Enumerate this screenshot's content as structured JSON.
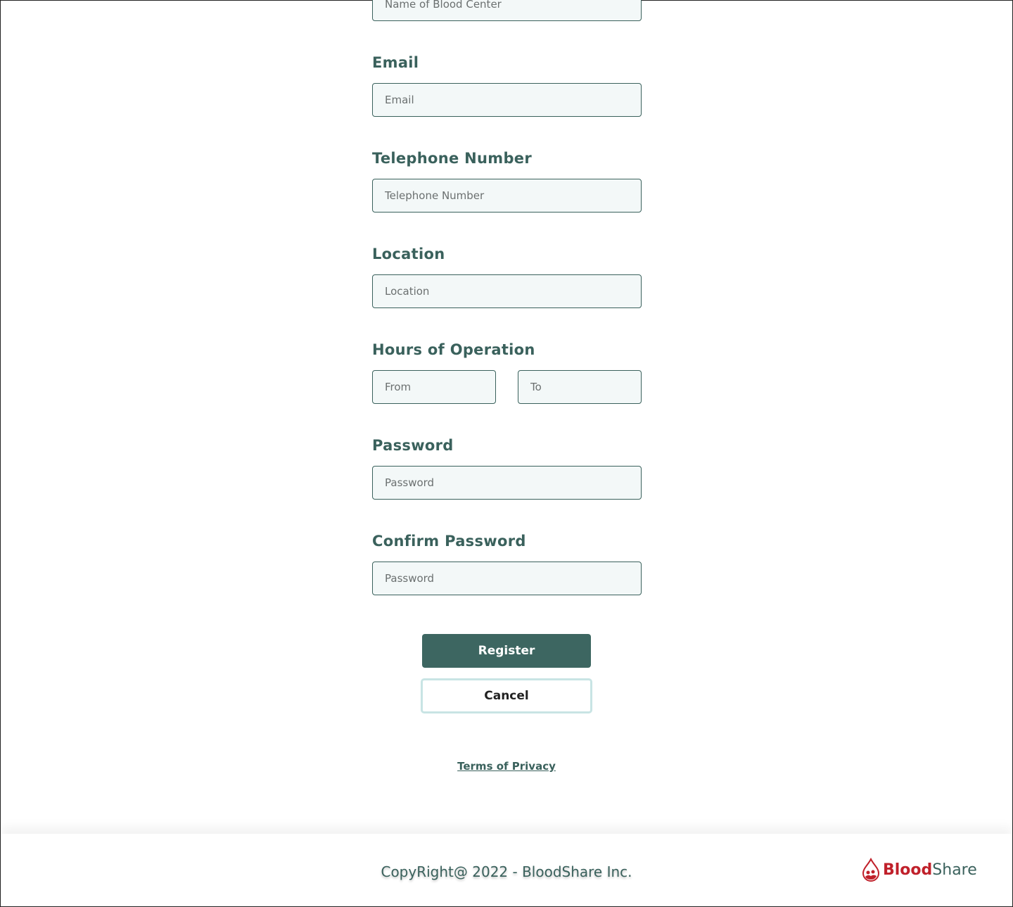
{
  "form": {
    "name_placeholder": "Name of Blood Center",
    "email_label": "Email",
    "email_placeholder": "Email",
    "phone_label": "Telephone Number",
    "phone_placeholder": "Telephone Number",
    "location_label": "Location",
    "location_placeholder": "Location",
    "hours_label": "Hours of Operation",
    "from_placeholder": "From",
    "to_placeholder": "To",
    "password_label": "Password",
    "password_placeholder": "Password",
    "confirm_label": "Confirm Password",
    "confirm_placeholder": "Password",
    "register_label": "Register",
    "cancel_label": "Cancel",
    "terms_label": "Terms of Privacy"
  },
  "footer": {
    "copyright": "CopyRight@ 2022 - BloodShare Inc.",
    "logo_blood": "Blood",
    "logo_share": "Share"
  },
  "colors": {
    "primary": "#3d6661",
    "brand_red": "#c0202a",
    "cancel_border": "#c8e4e4"
  }
}
